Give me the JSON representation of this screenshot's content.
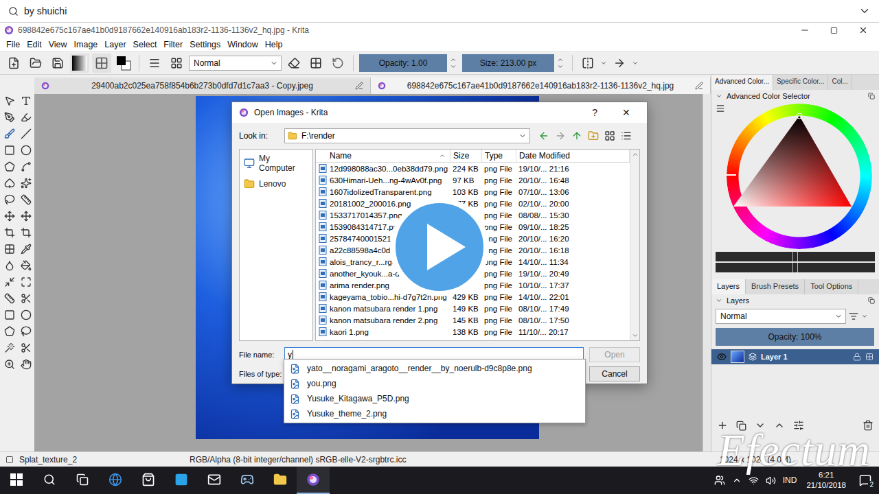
{
  "search": {
    "text": "by shuichi"
  },
  "window": {
    "title": "698842e675c167ae41b0d9187662e140916ab183r2-1136-1136v2_hq.jpg - Krita"
  },
  "menu": [
    "File",
    "Edit",
    "View",
    "Image",
    "Layer",
    "Select",
    "Filter",
    "Settings",
    "Window",
    "Help"
  ],
  "toolbar": {
    "blend_mode": "Normal",
    "opacity": {
      "label": "Opacity:  1.00",
      "level": 1.0
    },
    "size": {
      "label": "Size:  213.00 px",
      "level": 1.0
    }
  },
  "documents": [
    {
      "label": "29400ab2c025ea758f854b6b273b0dfd7d1c7aa3 - Copy.jpeg",
      "selected": false
    },
    {
      "label": "698842e675c167ae41b0d9187662e140916ab183r2-1136-1136v2_hq.jpg",
      "selected": true
    }
  ],
  "dialog": {
    "title": "Open Images - Krita",
    "help": "?",
    "close": "✕",
    "look_in_label": "Look in:",
    "look_in": "F:\\render",
    "places": [
      {
        "label": "My Computer",
        "kind": "computer"
      },
      {
        "label": "Lenovo",
        "kind": "folder"
      }
    ],
    "columns": [
      "Name",
      "Size",
      "Type",
      "Date Modified"
    ],
    "files": [
      {
        "name": "12d998088ac30...0eb38dd79.png",
        "size": "224 KB",
        "type": "png File",
        "date": "19/10/... 21:16"
      },
      {
        "name": "630Himari-Ueh...ng-4wAv0f.png",
        "size": "97 KB",
        "type": "png File",
        "date": "20/10/... 16:48"
      },
      {
        "name": "1607idolizedTransparent.png",
        "size": "103 KB",
        "type": "png File",
        "date": "07/10/... 13:06"
      },
      {
        "name": "20181002_200016.png",
        "size": "877 KB",
        "type": "png File",
        "date": "02/10/... 20:00"
      },
      {
        "name": "1533717014357.png",
        "size": "",
        "type": "png File",
        "date": "08/08/... 15:30"
      },
      {
        "name": "1539084314717.png",
        "size": "",
        "type": "png File",
        "date": "09/10/... 18:25"
      },
      {
        "name": "25784740001521...",
        "size": "",
        "type": "png File",
        "date": "20/10/... 16:20"
      },
      {
        "name": "a22c88598a4c0d...",
        "size": "",
        "type": "png File",
        "date": "20/10/... 16:18"
      },
      {
        "name": "alois_trancy_r...rg-...",
        "size": "",
        "type": "png File",
        "date": "14/10/... 11:34"
      },
      {
        "name": "another_kyouk...a-d...",
        "size": "",
        "type": "png File",
        "date": "19/10/... 20:49"
      },
      {
        "name": "arima render.png",
        "size": "",
        "type": "png File",
        "date": "10/10/... 17:37"
      },
      {
        "name": "kageyama_tobio...hi-d7g7t2n.png",
        "size": "429 KB",
        "type": "png File",
        "date": "14/10/... 22:01"
      },
      {
        "name": "kanon matsubara render 1.png",
        "size": "149 KB",
        "type": "png File",
        "date": "08/10/... 17:49"
      },
      {
        "name": "kanon matsubara render 2.png",
        "size": "145 KB",
        "type": "png File",
        "date": "08/10/... 17:50"
      },
      {
        "name": "kaori 1.png",
        "size": "138 KB",
        "type": "png File",
        "date": "11/10/... 20:17"
      }
    ],
    "file_name_label": "File name:",
    "file_name": "y",
    "files_of_type_label": "Files of type:",
    "open": {
      "label": "Open",
      "disabled": true
    },
    "cancel": "Cancel",
    "suggestions": [
      "yato__noragami_aragoto__render__by_noerulb-d9c8p8e.png",
      "you.png",
      "Yusuke_Kitagawa_P5D.png",
      "Yusuke_theme_2.png"
    ]
  },
  "docker": {
    "tabs": [
      {
        "label": "Advanced Color...",
        "selected": true
      },
      {
        "label": "Specific Color...",
        "selected": false
      },
      {
        "label": "Col...",
        "selected": false
      }
    ],
    "title": "Advanced Color Selector"
  },
  "layers": {
    "tabs": [
      {
        "label": "Layers",
        "selected": true
      },
      {
        "label": "Brush Presets",
        "selected": false
      },
      {
        "label": "Tool Options",
        "selected": false
      }
    ],
    "title": "Layers",
    "blend_mode": "Normal",
    "opacity": {
      "label": "Opacity:  100%",
      "level": 1.0
    },
    "items": [
      {
        "name": "Layer 1",
        "visible": true,
        "selected": true
      }
    ]
  },
  "status_bar": {
    "brush": "Splat_texture_2",
    "color_space": "RGB/Alpha (8-bit integer/channel)  sRGB-elle-V2-srgbtrc.icc",
    "size": "1024 x 1024 (4.0M)"
  },
  "taskbar": {
    "language": "IND",
    "time": "6:21",
    "date": "21/10/2018",
    "notifications": "2"
  },
  "watermark": "Efectum"
}
